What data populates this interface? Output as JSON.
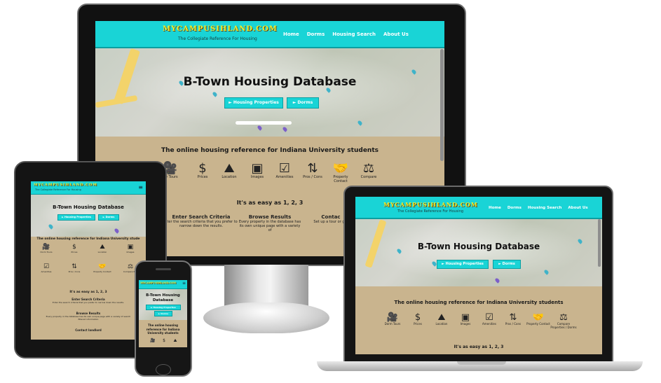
{
  "site": {
    "logo": "MYCAMPUSIHLAND.COM",
    "tagline": "The Collegiate Reference For Housing",
    "nav": [
      "Home",
      "Dorms",
      "Housing Search",
      "About Us"
    ],
    "hero_title": "B-Town Housing Database",
    "hero_title_short_line1": "B-Town Housing",
    "hero_title_short_line2": "Database",
    "buttons": [
      "Housing Properties",
      "Dorms"
    ],
    "section_title": "The online housing reference for Indiana University students",
    "section_title_tab": "The online housing reference for Indiana University stude",
    "section_title_phone": [
      "The online housing",
      "reference for Indiana",
      "University students"
    ],
    "features": [
      "Dorm Tours",
      "Prices",
      "Location",
      "Images",
      "Amenities",
      "Pros / Cons",
      "Property Contact",
      "Compare"
    ],
    "feature_laptop_extra": "Compare Properties / Dorms",
    "tab_features": [
      "Dorm Tours",
      "Prices",
      "Location",
      "Images",
      "Amenities",
      "Pros / Cons",
      "Property Contact",
      "Compare Pr..."
    ],
    "easy_title": "It's as easy as 1, 2, 3",
    "steps": [
      {
        "title": "Enter Search Criteria",
        "text": "Enter the search criteria that you prefer to narrow down the results."
      },
      {
        "title": "Browse Results",
        "text": "Every property in the database has its own unique page with a variety of"
      },
      {
        "title": "Contact Landlord",
        "text": "Set up a tour or get in touch with the property"
      }
    ],
    "monitor_step3_title": "Contac",
    "monitor_step3_text": "Set up a tour or get",
    "monitor_step1_text": "nter the search criteria that you prefer to narrow down the results.",
    "monitor_step2_text": "Every property in the database has its own unique page with a variety of",
    "tab_steps": [
      "Enter Search Criteria",
      "Browse Results",
      "Contact landlord"
    ],
    "tab_step_texts": [
      "Enter the search criteria that you prefer to narrow down the results.",
      "Every property in the database has its own unique page with a variety of search filtered information"
    ],
    "monitor_first_feature": "iew Tours"
  },
  "colors": {
    "nav": "#19d4d6",
    "logo": "#f2ec2a",
    "background": "#c9b48e"
  },
  "icons": [
    "film-camera-icon",
    "dollar-icon",
    "map-location-icon",
    "photos-icon",
    "checkbox-icon",
    "sort-arrows-icon",
    "handshake-icon",
    "scales-icon"
  ]
}
